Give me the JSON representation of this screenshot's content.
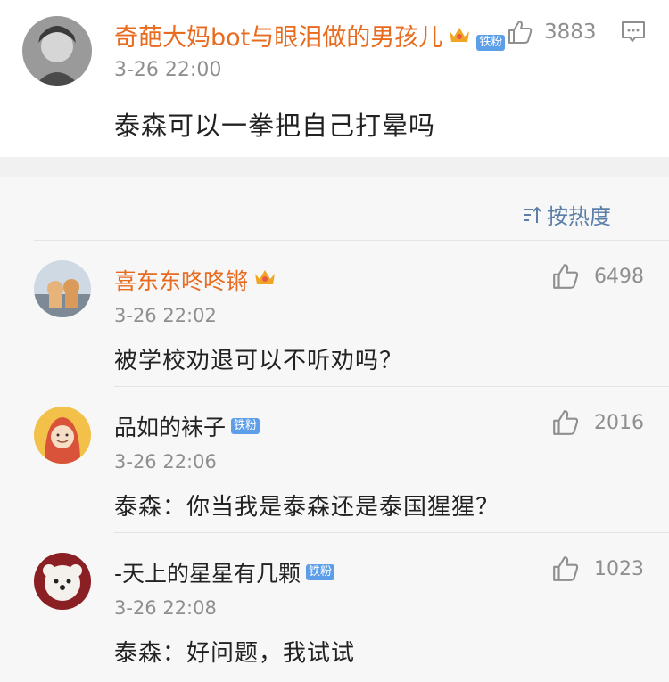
{
  "post": {
    "user_name": "奇葩大妈bot与眼泪做的男孩儿",
    "badge": "铁粉",
    "time": "3-26 22:00",
    "text": "泰森可以一拳把自己打晕吗",
    "like_count": "3883"
  },
  "sort": {
    "label": "按热度"
  },
  "comments": [
    {
      "user_name": "喜东东咚咚锵",
      "time": "3-26 22:02",
      "text": "被学校劝退可以不听劝吗？",
      "like_count": "6498"
    },
    {
      "user_name": "品如的袜子",
      "badge": "铁粉",
      "time": "3-26 22:06",
      "text": "泰森：你当我是泰森还是泰国猩猩？",
      "like_count": "2016"
    },
    {
      "user_name": "-天上的星星有几颗",
      "badge": "铁粉",
      "time": "3-26 22:08",
      "text": "泰森：好问题，我试试",
      "like_count": "1023"
    }
  ],
  "colors": {
    "vip_name": "#e86b1f",
    "meta_gray": "#8f8f8f",
    "badge_blue": "#5d9ee9",
    "sort_blue": "#5b7fa8",
    "bg_gray": "#f7f7f7"
  }
}
